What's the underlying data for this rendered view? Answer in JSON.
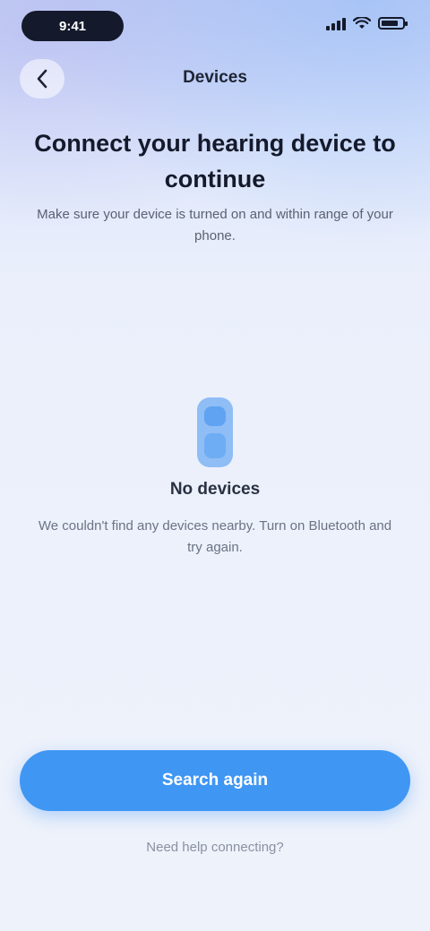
{
  "status_bar": {
    "time": "9:41",
    "signal_icon": "signal-icon",
    "wifi_icon": "wifi-icon",
    "battery_icon": "battery-icon",
    "battery_level": 0.8
  },
  "nav": {
    "back_icon": "chevron-left-icon",
    "title": "Devices"
  },
  "header": {
    "title": "Connect your hearing device to continue",
    "subtitle": "Make sure your device is turned on and within range of your phone."
  },
  "empty_state": {
    "icon": "hearing-device-icon",
    "title": "No devices",
    "description": "We couldn't find any devices nearby. Turn on Bluetooth and try again."
  },
  "actions": {
    "primary_label": "Search again",
    "secondary_label": "Need help connecting?"
  },
  "colors": {
    "accent": "#3f96f3",
    "background": "#edf1fb",
    "text_primary": "#141a2b",
    "text_secondary": "#6b7385"
  }
}
